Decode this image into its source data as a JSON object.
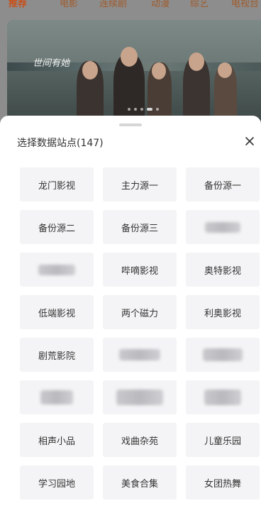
{
  "top_tabs": [
    "推荐",
    "电影",
    "连续剧",
    "动漫",
    "综艺",
    "电视台"
  ],
  "active_tab": "推荐",
  "banner": {
    "title": "世间有她",
    "slide_count": 5,
    "active_slide": 4
  },
  "sheet": {
    "title": "选择数据站点(147)",
    "close_icon": "close-icon",
    "items": [
      {
        "label": "龙门影视"
      },
      {
        "label": "主力源一"
      },
      {
        "label": "备份源一"
      },
      {
        "label": "备份源二"
      },
      {
        "label": "备份源三"
      },
      {
        "label": "",
        "obscured": true
      },
      {
        "label": "",
        "obscured": true
      },
      {
        "label": "哔嘀影视"
      },
      {
        "label": "奥特影视"
      },
      {
        "label": "低端影视"
      },
      {
        "label": "两个磁力"
      },
      {
        "label": "利奥影视"
      },
      {
        "label": "剧荒影院"
      },
      {
        "label": "",
        "obscured": true
      },
      {
        "label": "",
        "obscured": true
      },
      {
        "label": "",
        "obscured": true
      },
      {
        "label": "",
        "obscured": true
      },
      {
        "label": "",
        "obscured": true
      },
      {
        "label": "相声小品"
      },
      {
        "label": "戏曲杂苑"
      },
      {
        "label": "儿童乐园"
      },
      {
        "label": "学习园地"
      },
      {
        "label": "美食合集"
      },
      {
        "label": "女团热舞"
      }
    ]
  },
  "colors": {
    "accent": "#c9501a",
    "item_bg": "#f4f4f6",
    "sheet_bg": "#ffffff"
  }
}
